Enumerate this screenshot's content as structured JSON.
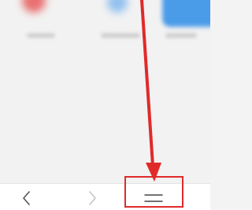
{
  "nav": {
    "back_icon": "chevron-left-icon",
    "forward_icon": "chevron-right-icon",
    "menu_icon": "menu-icon"
  },
  "annotation": {
    "color": "#e02a2a"
  }
}
